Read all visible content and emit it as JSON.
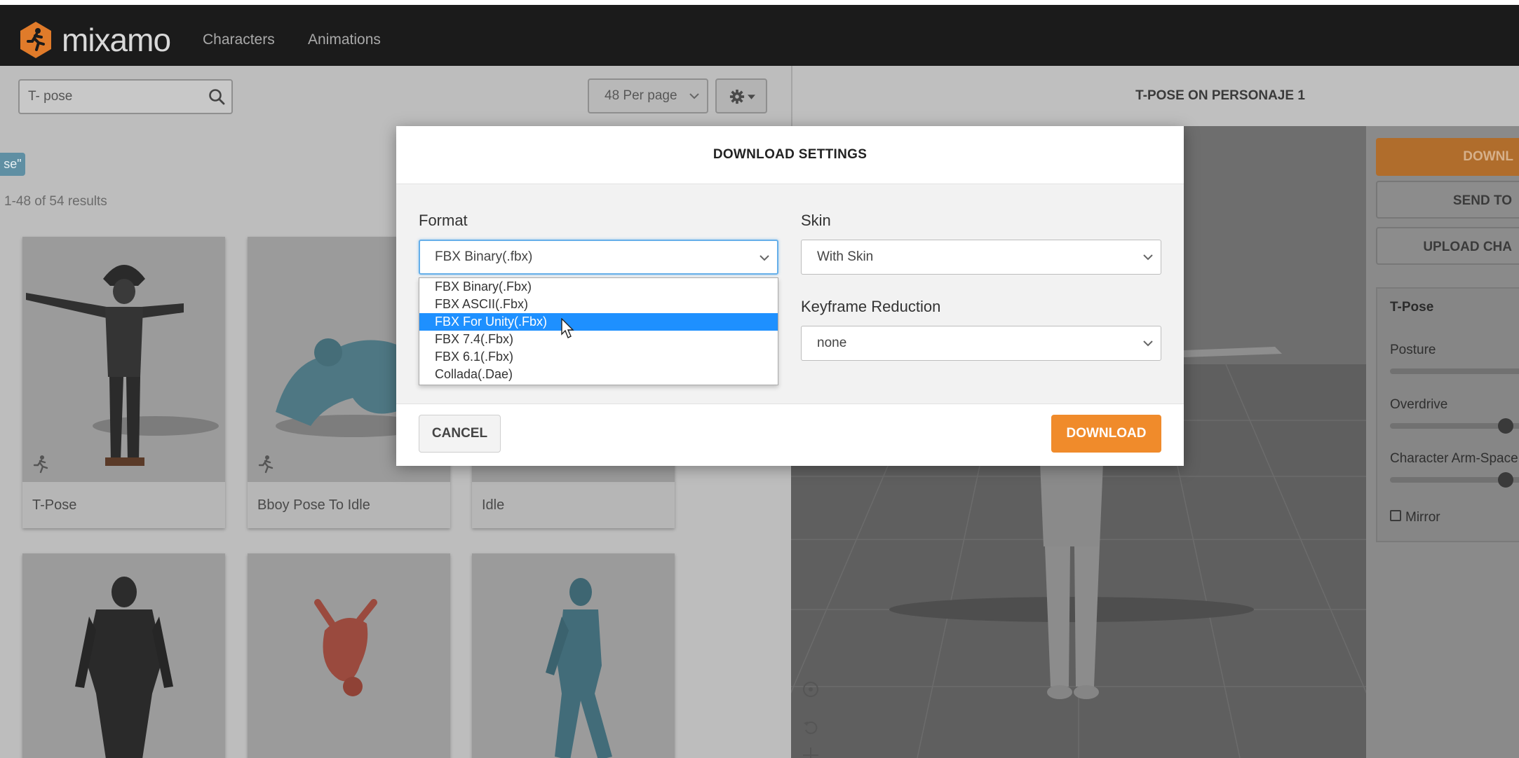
{
  "app": {
    "brand": "mixamo",
    "nav": [
      "Characters",
      "Animations"
    ]
  },
  "search": {
    "value": "T- pose"
  },
  "toolbar": {
    "per_page": "48 Per page"
  },
  "filters": {
    "tag": "se\"",
    "results": "1-48 of 54 results"
  },
  "cards": [
    {
      "label": "T-Pose"
    },
    {
      "label": "Bboy Pose To Idle"
    },
    {
      "label": "Idle"
    }
  ],
  "viewer": {
    "title": "T-POSE ON PERSONAJE 1"
  },
  "sidebar": {
    "download_label": "DOWNL",
    "send_label": "SEND TO",
    "upload_label": "UPLOAD CHA",
    "panel_title": "T-Pose",
    "posture_label": "Posture",
    "overdrive_label": "Overdrive",
    "armspace_label": "Character Arm-Space",
    "mirror_label": "Mirror"
  },
  "modal": {
    "title": "DOWNLOAD SETTINGS",
    "format_label": "Format",
    "format_value": "FBX Binary(.fbx)",
    "format_options": [
      "FBX Binary(.Fbx)",
      "FBX ASCII(.Fbx)",
      "FBX For Unity(.Fbx)",
      "FBX 7.4(.Fbx)",
      "FBX 6.1(.Fbx)",
      "Collada(.Dae)"
    ],
    "format_highlighted": "FBX For Unity(.Fbx)",
    "skin_label": "Skin",
    "skin_value": "With Skin",
    "keyframe_label": "Keyframe Reduction",
    "keyframe_value": "none",
    "cancel_label": "CANCEL",
    "download_label": "DOWNLOAD"
  },
  "colors": {
    "accent": "#f08b2b",
    "highlight": "#1e90ff",
    "navbar": "#1b1b1b"
  }
}
